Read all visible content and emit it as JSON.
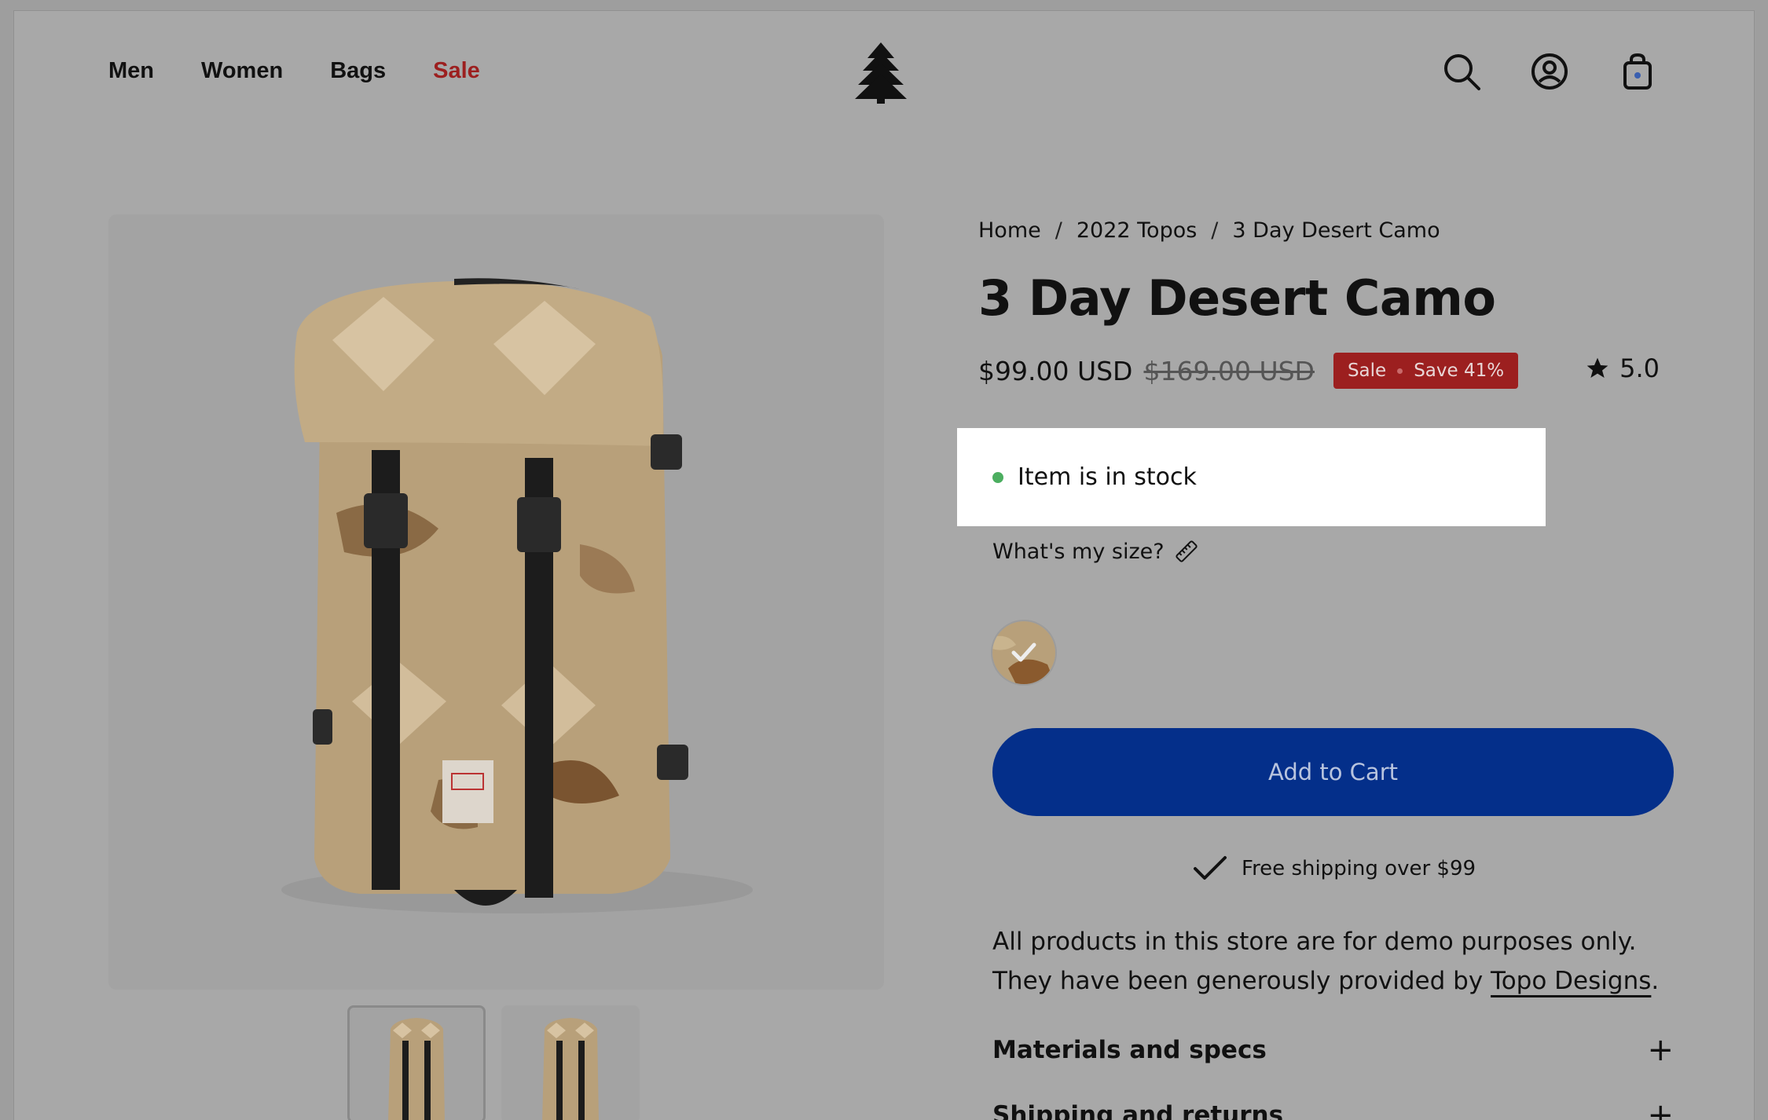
{
  "nav": {
    "items": [
      "Men",
      "Women",
      "Bags"
    ],
    "sale": "Sale"
  },
  "breadcrumb": {
    "home": "Home",
    "collection": "2022 Topos",
    "current": "3 Day Desert Camo"
  },
  "product": {
    "title": "3 Day Desert Camo",
    "price": "$99.00 USD",
    "compare_price": "$169.00 USD",
    "badge_sale": "Sale",
    "badge_save": "Save 41%",
    "rating": "5.0",
    "stock": "Item is in stock",
    "size_link": "What's my size?",
    "add_to_cart": "Add to Cart",
    "shipping": "Free shipping over $99",
    "desc_line1": "All products in this store are for demo purposes only.",
    "desc_line2_prefix": "They have been generously provided by ",
    "desc_link": "Topo Designs",
    "desc_line2_suffix": "."
  },
  "accordions": {
    "materials": "Materials and specs",
    "shipping": "Shipping and returns"
  },
  "colors": {
    "sale": "#9c1f1f",
    "cart_button": "#042f8a",
    "stock_dot": "#4cae60"
  },
  "icons": [
    "search-icon",
    "account-icon",
    "cart-icon",
    "star-icon",
    "ruler-icon",
    "check-icon",
    "plus-icon",
    "tree-logo"
  ]
}
